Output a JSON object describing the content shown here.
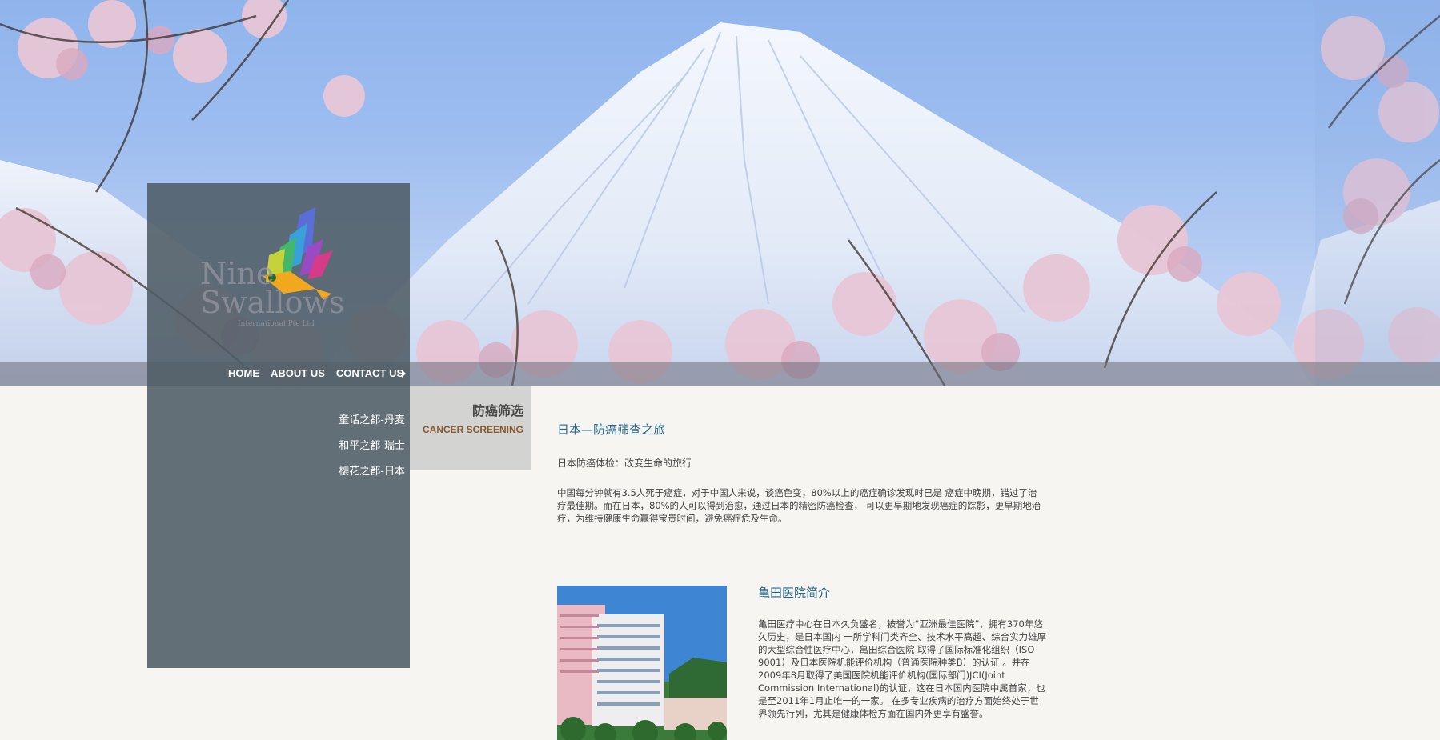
{
  "brand": {
    "logo_line1": "Nine",
    "logo_line2": "Swallows",
    "logo_tagline": "International Pte Ltd"
  },
  "main_nav": {
    "items": [
      {
        "label": "HOME"
      },
      {
        "label": "ABOUT US"
      },
      {
        "label": "CONTACT US"
      }
    ]
  },
  "sub_nav": {
    "items": [
      {
        "label": "童话之都-丹麦"
      },
      {
        "label": "和平之都-瑞士"
      },
      {
        "label": "樱花之都-日本"
      }
    ]
  },
  "section_tag": {
    "title_cn": "防癌筛选",
    "title_en": "CANCER SCREENING"
  },
  "article": {
    "title": "日本—防癌筛查之旅",
    "subtitle": "日本防癌体检：改变生命的旅行",
    "body": "中国每分钟就有3.5人死于癌症，对于中国人来说，谈癌色变，80%以上的癌症确诊发现时已是 癌症中晚期，错过了治疗最佳期。而在日本，80%的人可以得到治愈，通过日本的精密防癌检查， 可以更早期地发现癌症的踪影，更早期地治疗，为维持健康生命赢得宝贵时间，避免癌症危及生命。"
  },
  "hospital": {
    "title": "亀田医院简介",
    "body": "亀田医疗中心在日本久负盛名，被誉为“亚洲最佳医院”，拥有370年悠久历史，是日本国内 一所学科门类齐全、技术水平高超、综合实力雄厚的大型综合性医疗中心，亀田综合医院 取得了国际标准化组织（ISO 9001）及日本医院机能评价机构（普通医院种类B）的认证 。并在2009年8月取得了美国医院机能评价机构(国际部门)JCI(Joint Commission International)的认证，这在日本国内医院中属首家，也是至2011年1月止唯一的一家。 在多专业疾病的治疗方面始终处于世界领先行列，尤其是健康体检方面在国内外更享有盛誉。"
  },
  "colors": {
    "sidebar_bg": "#4e5c65",
    "section_tag_bg": "#d3d3d1",
    "title_blue": "#2b6a8c",
    "accent_brown": "#8a5a30",
    "page_bg": "#f6f5f2"
  }
}
